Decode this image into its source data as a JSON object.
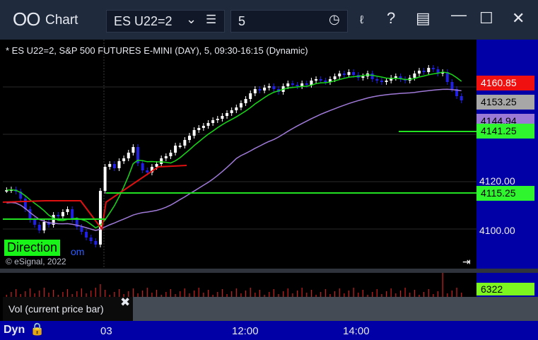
{
  "window": {
    "app_icon": "ОО",
    "title": "Chart",
    "symbol": "ES U22=2",
    "symbol_dropdown_icon": "chevron-down-icon",
    "symbol_list_icon": "list-icon",
    "interval": "5",
    "interval_clock_icon": "clock-icon",
    "tools": [
      "draw-icon",
      "help-icon",
      "template-icon",
      "minimize-icon",
      "maximize-icon",
      "close-icon"
    ],
    "help_glyph": "?"
  },
  "chart": {
    "info_line": "* ES U22=2, S&P 500 FUTURES E-MINI (DAY), 5, 09:30-16:15 (Dynamic)",
    "copyright": "© eSignal, 2022",
    "direction_label": "Direction",
    "direction_suffix": "om",
    "price_axis": [
      "4120.00",
      "4100.00"
    ],
    "price_tags": [
      {
        "label": "4160.85",
        "bg": "#f01010",
        "fg": "#ffffff"
      },
      {
        "label": "4153.25",
        "bg": "#a7a7a7",
        "fg": "#000000"
      },
      {
        "label": "4144.94",
        "bg": "#9b7ad6",
        "fg": "#000000"
      },
      {
        "label": "4141.25",
        "bg": "#2ef52e",
        "fg": "#000000"
      },
      {
        "label": "4115.25",
        "bg": "#2ef52e",
        "fg": "#000000"
      }
    ],
    "colors": {
      "up": "#ffffff",
      "down": "#2020e6",
      "ema_fast": "#18d818",
      "ema_slow": "#a07ad8",
      "pivot": "#e01010",
      "level": "#22e022"
    }
  },
  "volume": {
    "current": "6322",
    "panel_label": "Vol (current price bar)"
  },
  "time_axis": {
    "mode": "Dyn",
    "labels": [
      "03",
      "12:00",
      "14:00"
    ]
  }
}
